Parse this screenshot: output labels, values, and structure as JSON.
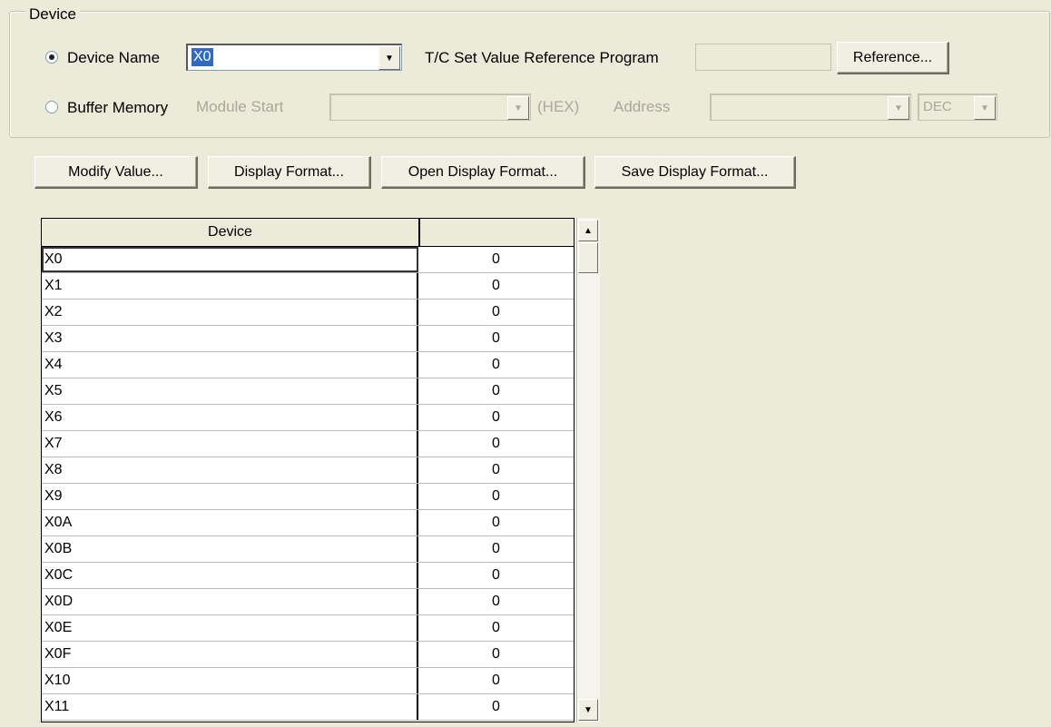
{
  "device_group": {
    "title": "Device",
    "device_name_label": "Device Name",
    "device_name_value": "X0",
    "tc_label": "T/C Set Value Reference Program",
    "tc_value": "",
    "reference_button": "Reference...",
    "buffer_memory_label": "Buffer Memory",
    "module_start_label": "Module Start",
    "module_start_value": "",
    "hex_label": "(HEX)",
    "address_label": "Address",
    "address_value": "",
    "radix_value": "DEC"
  },
  "toolbar": {
    "modify_value": "Modify Value...",
    "display_format": "Display Format...",
    "open_display_format": "Open Display Format...",
    "save_display_format": "Save Display Format..."
  },
  "grid": {
    "columns": [
      "Device",
      ""
    ],
    "rows": [
      {
        "device": "X0",
        "value": "0"
      },
      {
        "device": "X1",
        "value": "0"
      },
      {
        "device": "X2",
        "value": "0"
      },
      {
        "device": "X3",
        "value": "0"
      },
      {
        "device": "X4",
        "value": "0"
      },
      {
        "device": "X5",
        "value": "0"
      },
      {
        "device": "X6",
        "value": "0"
      },
      {
        "device": "X7",
        "value": "0"
      },
      {
        "device": "X8",
        "value": "0"
      },
      {
        "device": "X9",
        "value": "0"
      },
      {
        "device": "X0A",
        "value": "0"
      },
      {
        "device": "X0B",
        "value": "0"
      },
      {
        "device": "X0C",
        "value": "0"
      },
      {
        "device": "X0D",
        "value": "0"
      },
      {
        "device": "X0E",
        "value": "0"
      },
      {
        "device": "X0F",
        "value": "0"
      },
      {
        "device": "X10",
        "value": "0"
      },
      {
        "device": "X11",
        "value": "0"
      }
    ]
  },
  "colors": {
    "background": "#ecead8",
    "selection": "#316ac5"
  }
}
